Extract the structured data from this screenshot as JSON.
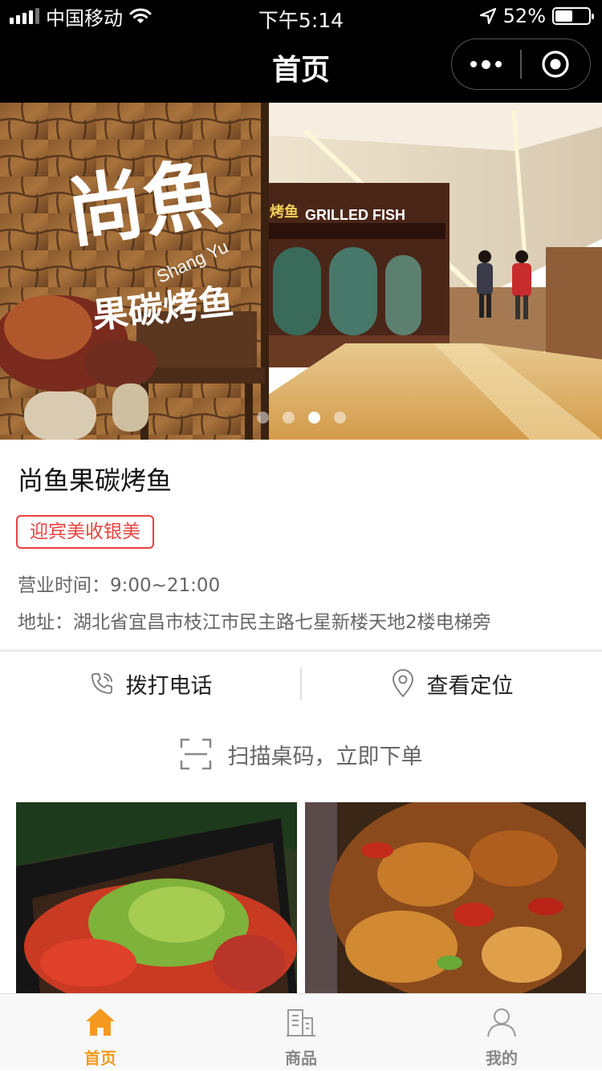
{
  "status_bar": {
    "carrier": "中国移动",
    "time": "下午5:14",
    "battery_percent": "52%",
    "battery_level": 0.52
  },
  "nav": {
    "title": "首页"
  },
  "banner": {
    "sign_logo_text": "尚魚",
    "sign_pinyin": "Shang Yu",
    "sign_subtitle": "果碳烤鱼",
    "storefront_text": "GRILLED FISH",
    "storefront_cn": "烤鱼",
    "slide_count": 4,
    "active_slide": 3
  },
  "store": {
    "name": "尚鱼果碳烤鱼",
    "tag": "迎宾美收银美",
    "hours": "营业时间：9:00~21:00",
    "address": "地址：湖北省宜昌市枝江市民主路七星新楼天地2楼电梯旁"
  },
  "actions": {
    "call_label": "拨打电话",
    "location_label": "查看定位"
  },
  "scan": {
    "label": "扫描桌码，立即下单"
  },
  "tabs": [
    {
      "label": "首页",
      "icon": "home-icon",
      "active": true
    },
    {
      "label": "商品",
      "icon": "building-icon",
      "active": false
    },
    {
      "label": "我的",
      "icon": "user-icon",
      "active": false
    }
  ],
  "colors": {
    "accent": "#f39a1e",
    "tag_red": "#e64340",
    "nav_bg": "#000000"
  }
}
